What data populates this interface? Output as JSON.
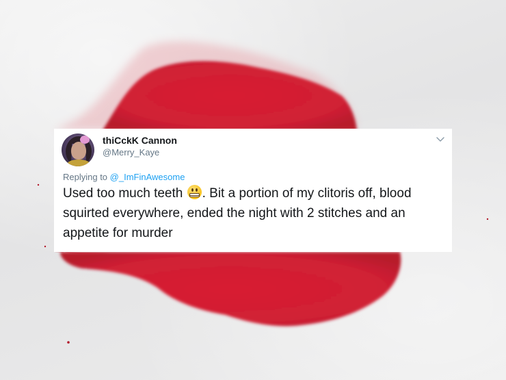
{
  "background": {
    "stain_color": "#d81f33",
    "fabric_color": "#e9e9ea"
  },
  "tweet": {
    "display_name": "thiCckK Cannon",
    "handle": "@Merry_Kaye",
    "replying_prefix": "Replying to ",
    "replying_to": "@_ImFinAwesome",
    "text_part1": "Used too much teeth ",
    "emoji": "grimacing-face",
    "text_part2": ". Bit a portion of my clitoris off, blood squirted everywhere, ended the night with 2 stitches and an appetite for murder",
    "link_color": "#1da1f2",
    "menu_icon": "chevron-down-icon"
  }
}
